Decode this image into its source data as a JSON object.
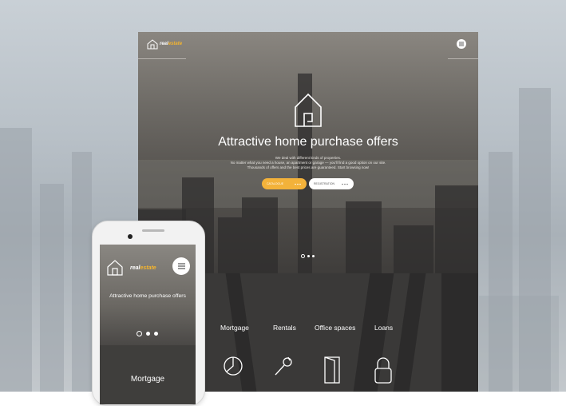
{
  "desktop": {
    "logo": {
      "part1": "real",
      "part2": "estate"
    },
    "hero": {
      "title": "Attractive home purchase offers",
      "desc1": "We deal with different kinds of properties.",
      "desc2": "No matter what you need a house, an apartment or garage — you'll find a good option on our site.",
      "desc3": "Thousands of offers and the best prices are guaranteed. Start browsing now!",
      "btn_primary": "CATALOGUE",
      "btn_secondary": "REGISTRATION",
      "slides_total": 3,
      "slides_active_index": 0
    },
    "tabs": [
      "Mortgage",
      "Rentals",
      "Office spaces",
      "Loans"
    ],
    "icons": [
      "pie-chart-icon",
      "wrench-icon",
      "door-icon",
      "lock-icon"
    ]
  },
  "phone": {
    "logo": {
      "part1": "real",
      "part2": "estate"
    },
    "title": "Attractive home purchase offers",
    "section": "Mortgage",
    "slides_total": 3,
    "slides_active_index": 0
  },
  "colors": {
    "accent": "#f3b23a",
    "dark": "#3a3938"
  }
}
